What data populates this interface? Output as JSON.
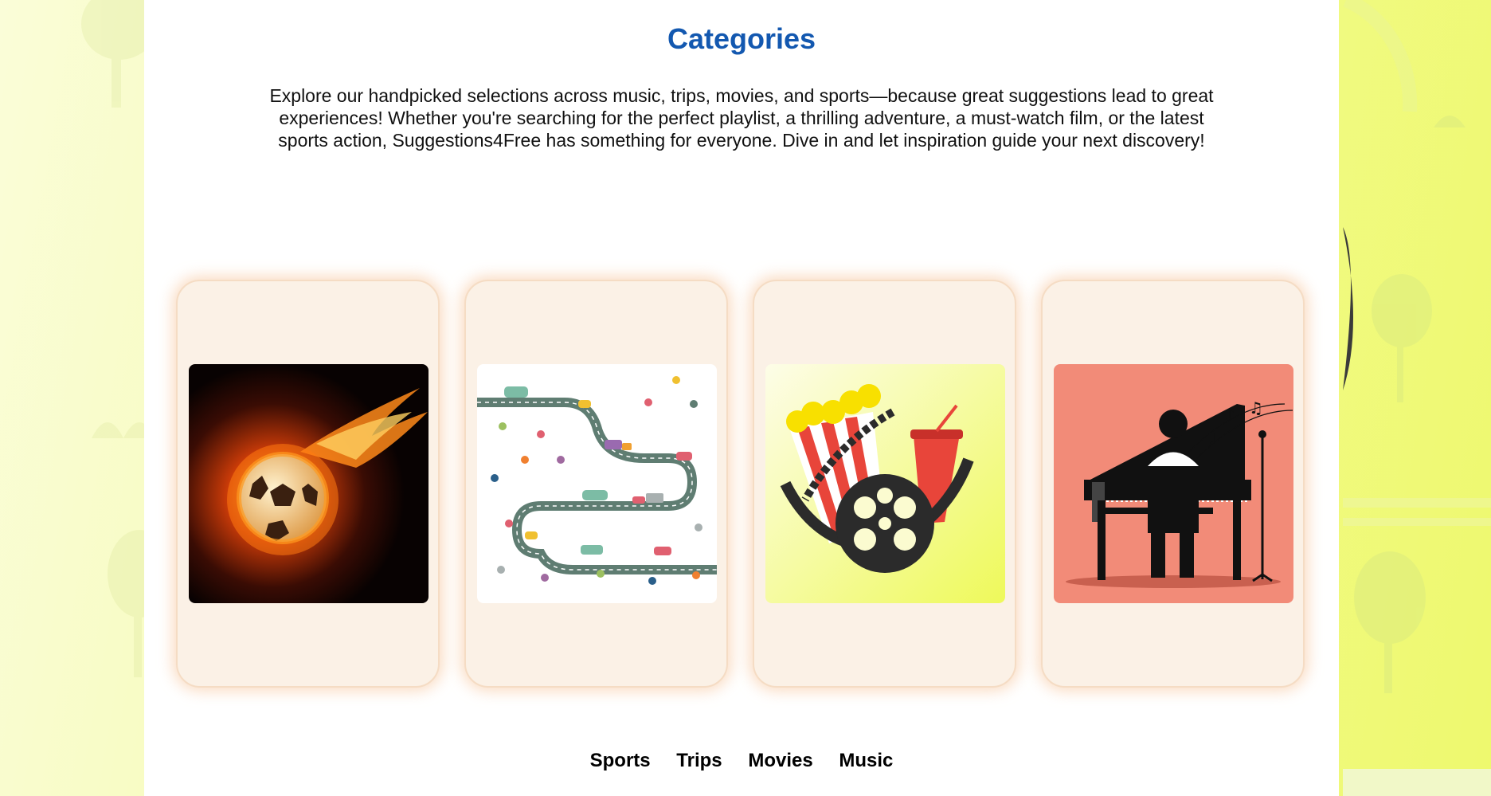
{
  "header": {
    "title": "Categories"
  },
  "intro": {
    "text": "Explore our handpicked selections across music, trips, movies, and sports—because great suggestions lead to great experiences! Whether you're searching for the perfect playlist, a thrilling adventure, a must-watch film, or the latest sports action, Suggestions4Free has something for everyone. Dive in and let inspiration guide your next discovery!"
  },
  "cards": [
    {
      "image": "flaming-soccer-ball"
    },
    {
      "image": "winding-road-with-cars"
    },
    {
      "image": "popcorn-film-reel"
    },
    {
      "image": "pianist-at-grand-piano"
    }
  ],
  "category_nav": {
    "items": [
      "Sports",
      "Trips",
      "Movies",
      "Music"
    ]
  },
  "colors": {
    "title": "#1358b0",
    "card_bg": "#fbf1e6",
    "card_glow": "#f8c8a0",
    "page_bg": "#f4fa9e"
  }
}
